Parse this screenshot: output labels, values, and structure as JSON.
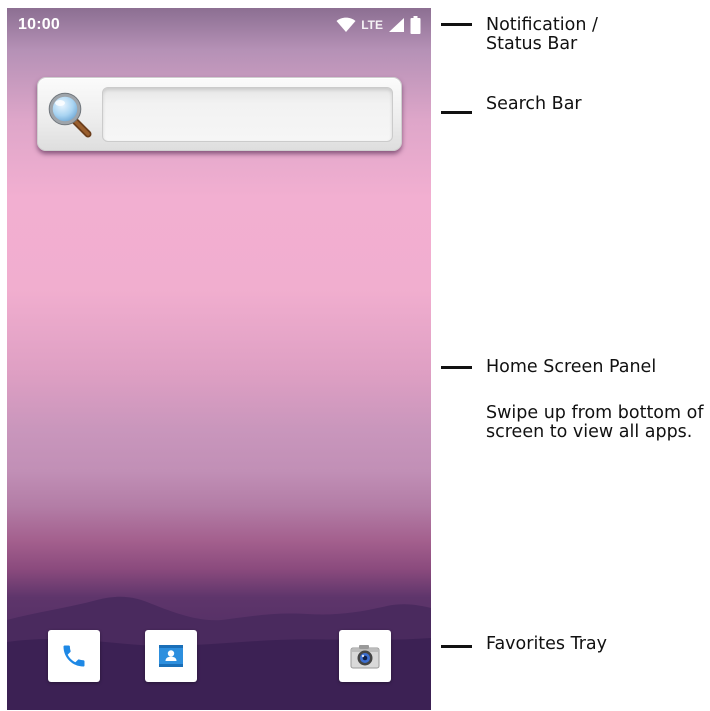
{
  "status_bar": {
    "time": "10:00",
    "network": "LTE",
    "icons": [
      "wifi-icon",
      "signal-icon",
      "battery-icon"
    ]
  },
  "search_widget": {
    "icon": "magnifier-icon",
    "value": "",
    "placeholder": ""
  },
  "favorites_tray": [
    {
      "name": "phone",
      "icon": "phone-icon",
      "color": "#1e88e5"
    },
    {
      "name": "contacts",
      "icon": "contacts-icon",
      "color": "#2d8fde"
    },
    {
      "name": "camera",
      "icon": "camera-icon",
      "color": "#555555"
    }
  ],
  "callouts": {
    "notification": "Notification /\nStatus Bar",
    "search": "Search Bar",
    "home_panel": "Home Screen Panel",
    "home_panel_note": "Swipe up from bottom of screen to view all apps.",
    "favorites": "Favorites Tray"
  },
  "colors": {
    "sky_top": "#8c6f92",
    "sky_mid": "#f2afd1",
    "dusk": "#a35f8d",
    "mountains": "#3f2357"
  }
}
